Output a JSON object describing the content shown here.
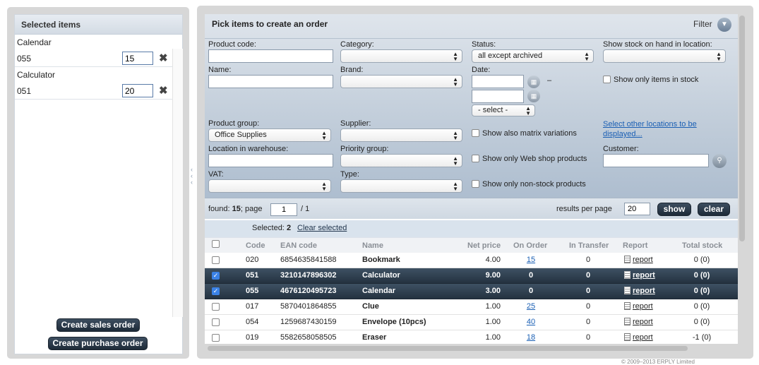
{
  "selected_panel": {
    "title": "Selected items",
    "items": [
      {
        "name": "Calendar",
        "code": "055",
        "qty": "15"
      },
      {
        "name": "Calculator",
        "code": "051",
        "qty": "20"
      }
    ],
    "create_sales_order": "Create sales order",
    "create_purchase_order": "Create purchase order"
  },
  "pick_panel": {
    "title": "Pick items to create an order",
    "filter_label": "Filter"
  },
  "filters": {
    "product_code_label": "Product code:",
    "category_label": "Category:",
    "status_label": "Status:",
    "status_value": "all except archived",
    "stock_location_label": "Show stock on hand in location:",
    "name_label": "Name:",
    "brand_label": "Brand:",
    "date_label": "Date:",
    "date_dash": "–",
    "date_select": "- select -",
    "only_in_stock_label": "Show only items in stock",
    "product_group_label": "Product group:",
    "product_group_value": "Office Supplies",
    "supplier_label": "Supplier:",
    "matrix_label": "Show also matrix variations",
    "other_locations_link": "Select other locations to be displayed...",
    "location_label": "Location in warehouse:",
    "priority_label": "Priority group:",
    "webshop_label": "Show only Web shop products",
    "customer_label": "Customer:",
    "vat_label": "VAT:",
    "type_label": "Type:",
    "nonstock_label": "Show only non-stock products"
  },
  "pager": {
    "found_prefix": "found: ",
    "found_count": "15",
    "page_text": "; page",
    "page_value": "1",
    "page_total": "/ 1",
    "results_label": "results per page",
    "results_value": "20",
    "show_button": "show",
    "clear_button": "clear"
  },
  "selection": {
    "selected_label": "Selected:",
    "selected_count": "2",
    "clear_selected": "Clear selected"
  },
  "grid": {
    "headers": {
      "code": "Code",
      "ean": "EAN code",
      "name": "Name",
      "net_price": "Net price",
      "on_order": "On Order",
      "in_transfer": "In Transfer",
      "report": "Report",
      "total_stock": "Total stock"
    },
    "rows": [
      {
        "code": "020",
        "ean": "6854635841588",
        "name": "Bookmark",
        "price": "4.00",
        "on_order": "15",
        "in_transfer": "0",
        "report": "report",
        "total": "0 (0)",
        "selected": false
      },
      {
        "code": "051",
        "ean": "3210147896302",
        "name": "Calculator",
        "price": "9.00",
        "on_order": "0",
        "in_transfer": "0",
        "report": "report",
        "total": "0 (0)",
        "selected": true
      },
      {
        "code": "055",
        "ean": "4676120495723",
        "name": "Calendar",
        "price": "3.00",
        "on_order": "0",
        "in_transfer": "0",
        "report": "report",
        "total": "0 (0)",
        "selected": true
      },
      {
        "code": "017",
        "ean": "5870401864855",
        "name": "Clue",
        "price": "1.00",
        "on_order": "25",
        "in_transfer": "0",
        "report": "report",
        "total": "0 (0)",
        "selected": false
      },
      {
        "code": "054",
        "ean": "1259687430159",
        "name": "Envelope (10pcs)",
        "price": "1.00",
        "on_order": "40",
        "in_transfer": "0",
        "report": "report",
        "total": "0 (0)",
        "selected": false
      },
      {
        "code": "019",
        "ean": "5582658058505",
        "name": "Eraser",
        "price": "1.00",
        "on_order": "18",
        "in_transfer": "0",
        "report": "report",
        "total": "-1 (0)",
        "selected": false
      }
    ]
  },
  "footer": {
    "copyright": "© 2009–2013 ERPLY Limited"
  },
  "colors": {
    "selected_row": "#2f3f4f",
    "filter_bg": "#b8c6d6",
    "link": "#1a5fb4"
  }
}
